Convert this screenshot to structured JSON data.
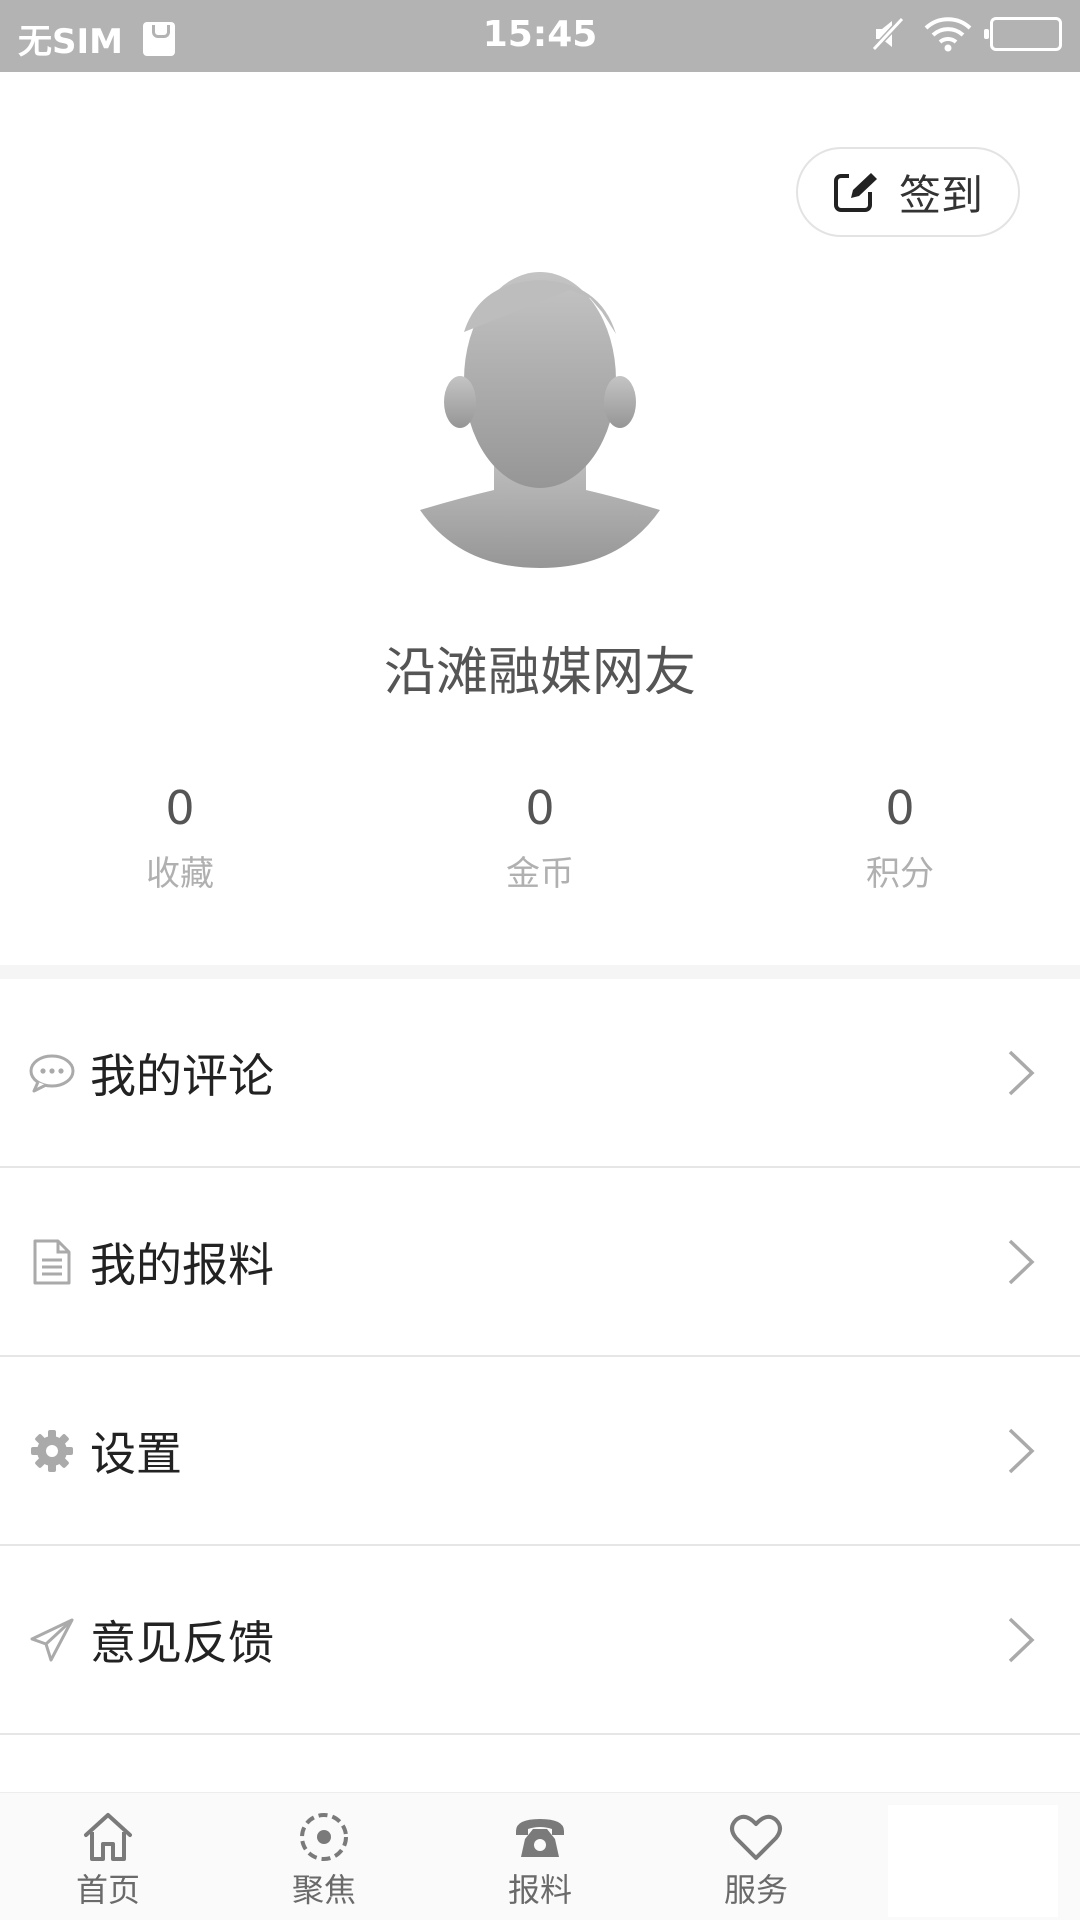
{
  "status_bar": {
    "carrier": "无SIM",
    "time": "15:45"
  },
  "header": {
    "checkin_label": "签到"
  },
  "profile": {
    "username": "沿滩融媒网友"
  },
  "stats": [
    {
      "value": "0",
      "label": "收藏"
    },
    {
      "value": "0",
      "label": "金币"
    },
    {
      "value": "0",
      "label": "积分"
    }
  ],
  "menu": {
    "items": [
      {
        "label": "我的评论",
        "icon": "comment-icon"
      },
      {
        "label": "我的报料",
        "icon": "document-icon"
      },
      {
        "label": "设置",
        "icon": "gear-icon"
      },
      {
        "label": "意见反馈",
        "icon": "paper-plane-icon"
      }
    ]
  },
  "tabbar": {
    "items": [
      {
        "label": "首页",
        "icon": "home-icon"
      },
      {
        "label": "聚焦",
        "icon": "focus-icon"
      },
      {
        "label": "报料",
        "icon": "phone-icon"
      },
      {
        "label": "服务",
        "icon": "heart-icon"
      }
    ]
  },
  "colors": {
    "status_bar": "#b3b3b3",
    "text_primary": "#222222",
    "text_secondary": "#b0b0b0"
  }
}
